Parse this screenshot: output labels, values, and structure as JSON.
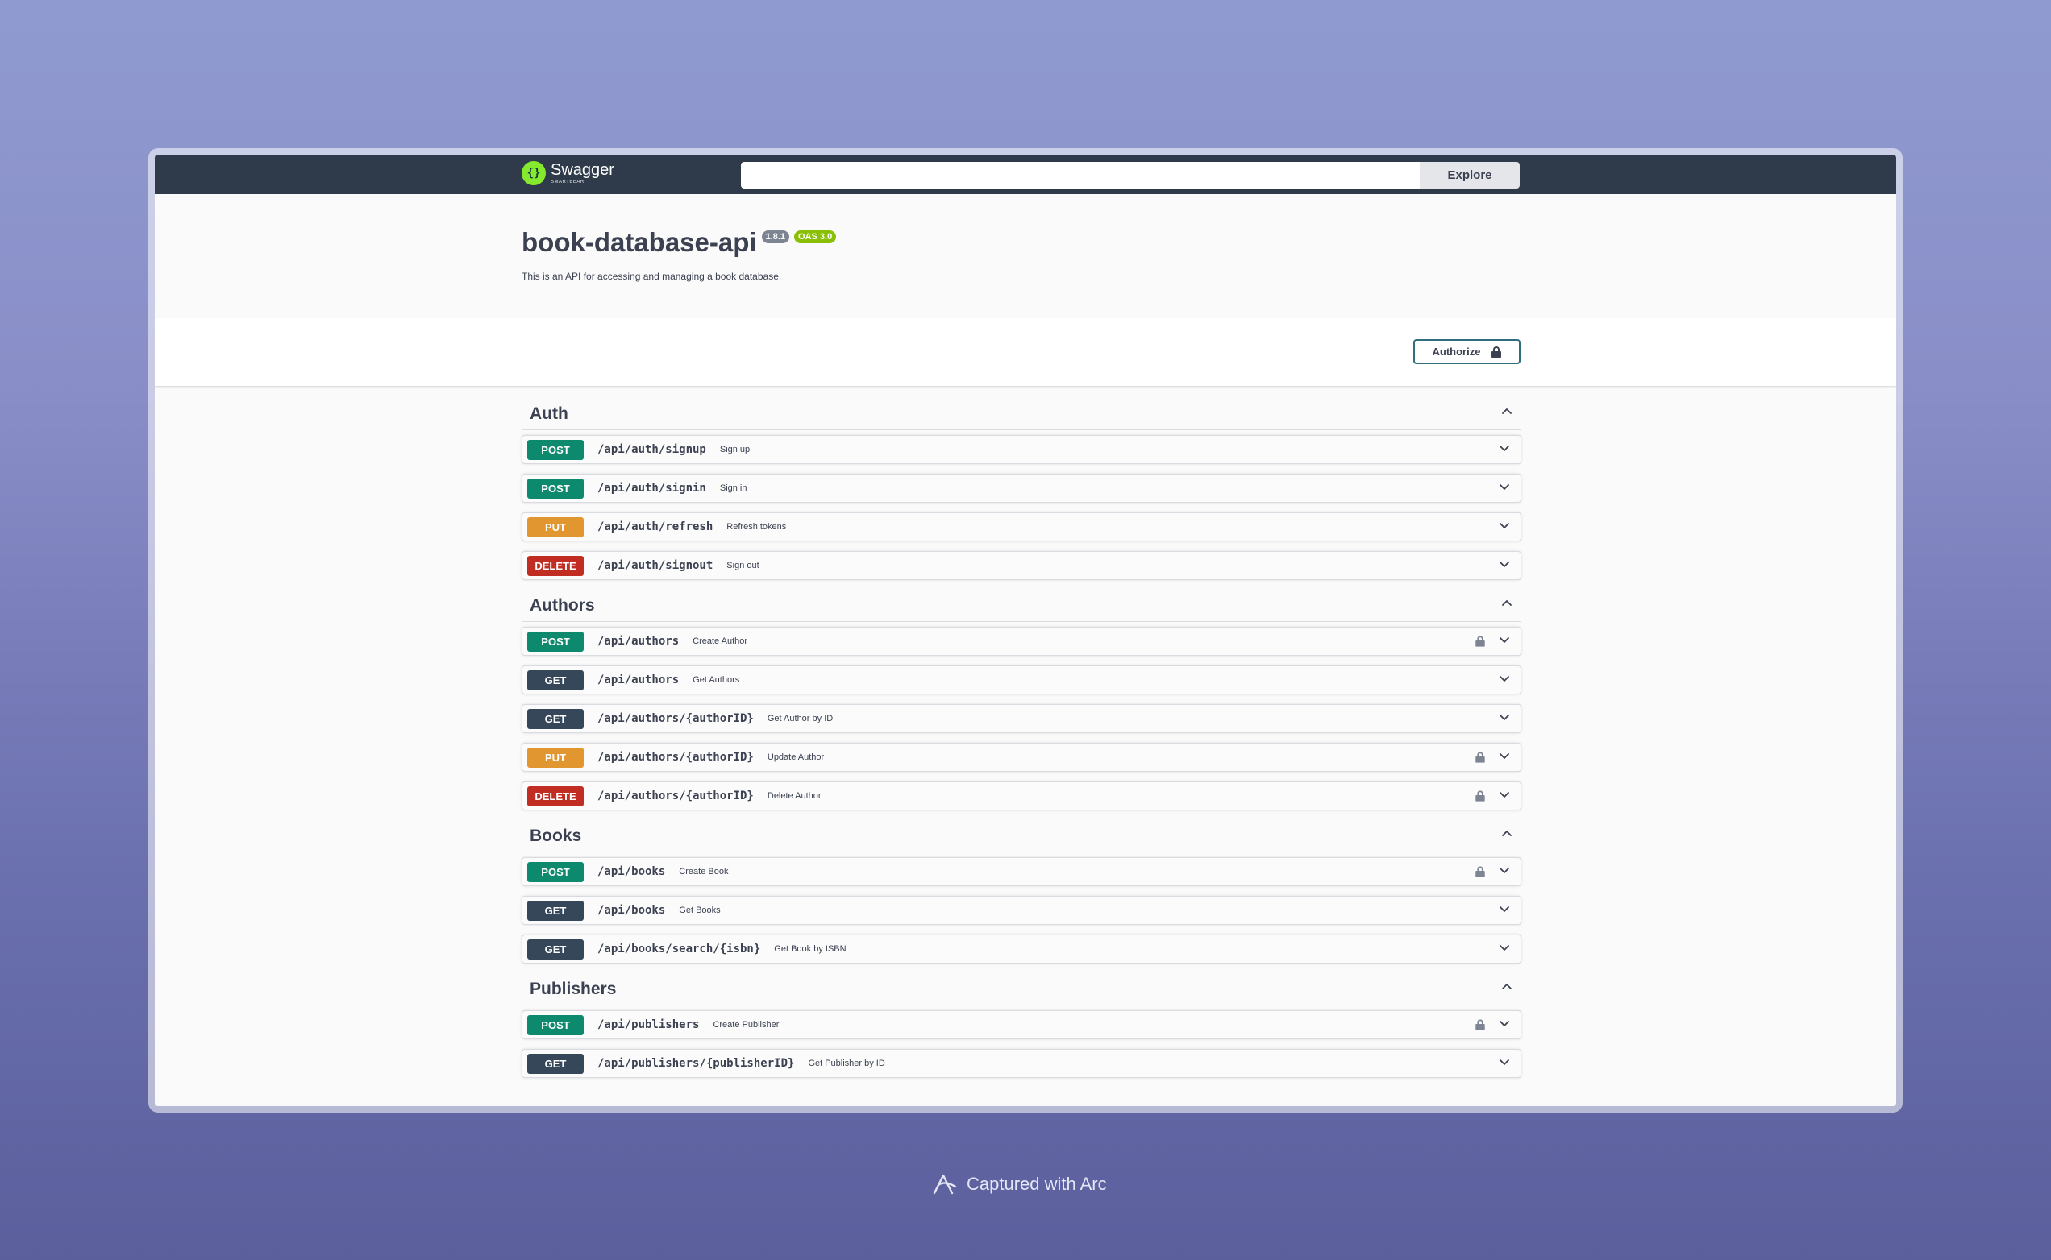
{
  "topbar": {
    "logo_text": "Swagger",
    "logo_sub": "SMARTBEAR",
    "search_placeholder": "",
    "explore_label": "Explore"
  },
  "info": {
    "title": "book-database-api",
    "version": "1.8.1",
    "oas": "OAS 3.0",
    "description": "This is an API for accessing and managing a book database."
  },
  "scheme": {
    "authorize_label": "Authorize"
  },
  "sections": [
    {
      "name": "Auth",
      "ops": [
        {
          "method": "POST",
          "path": "/api/auth/signup",
          "summary": "Sign up",
          "locked": false
        },
        {
          "method": "POST",
          "path": "/api/auth/signin",
          "summary": "Sign in",
          "locked": false
        },
        {
          "method": "PUT",
          "path": "/api/auth/refresh",
          "summary": "Refresh tokens",
          "locked": false
        },
        {
          "method": "DELETE",
          "path": "/api/auth/signout",
          "summary": "Sign out",
          "locked": false
        }
      ]
    },
    {
      "name": "Authors",
      "ops": [
        {
          "method": "POST",
          "path": "/api/authors",
          "summary": "Create Author",
          "locked": true
        },
        {
          "method": "GET",
          "path": "/api/authors",
          "summary": "Get Authors",
          "locked": false
        },
        {
          "method": "GET",
          "path": "/api/authors/{authorID}",
          "summary": "Get Author by ID",
          "locked": false
        },
        {
          "method": "PUT",
          "path": "/api/authors/{authorID}",
          "summary": "Update Author",
          "locked": true
        },
        {
          "method": "DELETE",
          "path": "/api/authors/{authorID}",
          "summary": "Delete Author",
          "locked": true
        }
      ]
    },
    {
      "name": "Books",
      "ops": [
        {
          "method": "POST",
          "path": "/api/books",
          "summary": "Create Book",
          "locked": true
        },
        {
          "method": "GET",
          "path": "/api/books",
          "summary": "Get Books",
          "locked": false
        },
        {
          "method": "GET",
          "path": "/api/books/search/{isbn}",
          "summary": "Get Book by ISBN",
          "locked": false
        }
      ]
    },
    {
      "name": "Publishers",
      "ops": [
        {
          "method": "POST",
          "path": "/api/publishers",
          "summary": "Create Publisher",
          "locked": true
        },
        {
          "method": "GET",
          "path": "/api/publishers/{publisherID}",
          "summary": "Get Publisher by ID",
          "locked": false
        }
      ]
    }
  ],
  "footer": {
    "capture_text": "Captured with Arc"
  },
  "colors": {
    "post": "#0d8a6d",
    "get": "#36475a",
    "put": "#e2962f",
    "delete": "#c22d23"
  }
}
